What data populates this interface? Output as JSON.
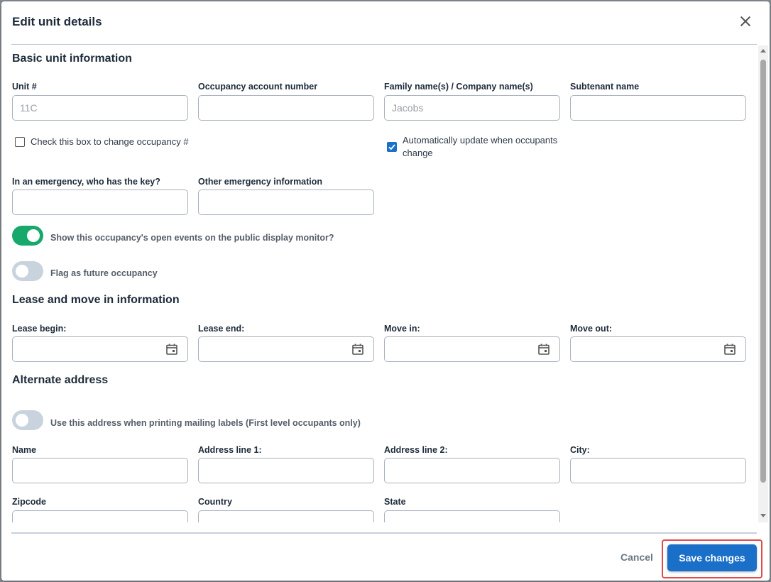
{
  "backdrop": {
    "partial_text": "",
    "status_text": ""
  },
  "dialog": {
    "title": "Edit unit details",
    "basic": {
      "section_title": "Basic unit information",
      "unit_label": "Unit #",
      "unit_value": "11C",
      "occupancy_account_label": "Occupancy account number",
      "occupancy_account_value": "",
      "family_name_label": "Family name(s) / Company name(s)",
      "family_name_value": "Jacobs",
      "subtenant_label": "Subtenant name",
      "subtenant_value": "",
      "change_occupancy_label": "Check this box to change occupancy #",
      "change_occupancy_checked": false,
      "auto_update_label_line1": "Automatically update when occupants",
      "auto_update_label_line2": "change",
      "auto_update_checked": true,
      "emergency_key_label": "In an emergency, who has the key?",
      "emergency_key_value": "",
      "other_emergency_label": "Other emergency information",
      "other_emergency_value": "",
      "public_display_label": "Show this occupancy's open events on the public display monitor?",
      "public_display_on": true,
      "future_occupancy_label": "Flag as future occupancy",
      "future_occupancy_on": false
    },
    "lease": {
      "section_title": "Lease and move in information",
      "lease_begin_label": "Lease begin:",
      "lease_end_label": "Lease end:",
      "move_in_label": "Move in:",
      "move_out_label": "Move out:"
    },
    "alternate": {
      "section_title": "Alternate address",
      "mailing_labels_toggle_label": "Use this address when printing mailing labels (First level occupants only)",
      "mailing_labels_on": false,
      "name_label": "Name",
      "address1_label": "Address line 1:",
      "address2_label": "Address line 2:",
      "city_label": "City:",
      "zipcode_label": "Zipcode",
      "country_label": "Country",
      "state_label": "State"
    },
    "footer": {
      "cancel_label": "Cancel",
      "save_label": "Save changes"
    }
  },
  "colors": {
    "primary": "#1a6fc9",
    "toggle_on": "#17a86b",
    "toggle_off": "#c9d3de",
    "highlight": "#e04c4c",
    "heading": "#1d2b3a"
  },
  "icons": [
    "close-icon",
    "calendar-icon",
    "checkmark-icon"
  ]
}
